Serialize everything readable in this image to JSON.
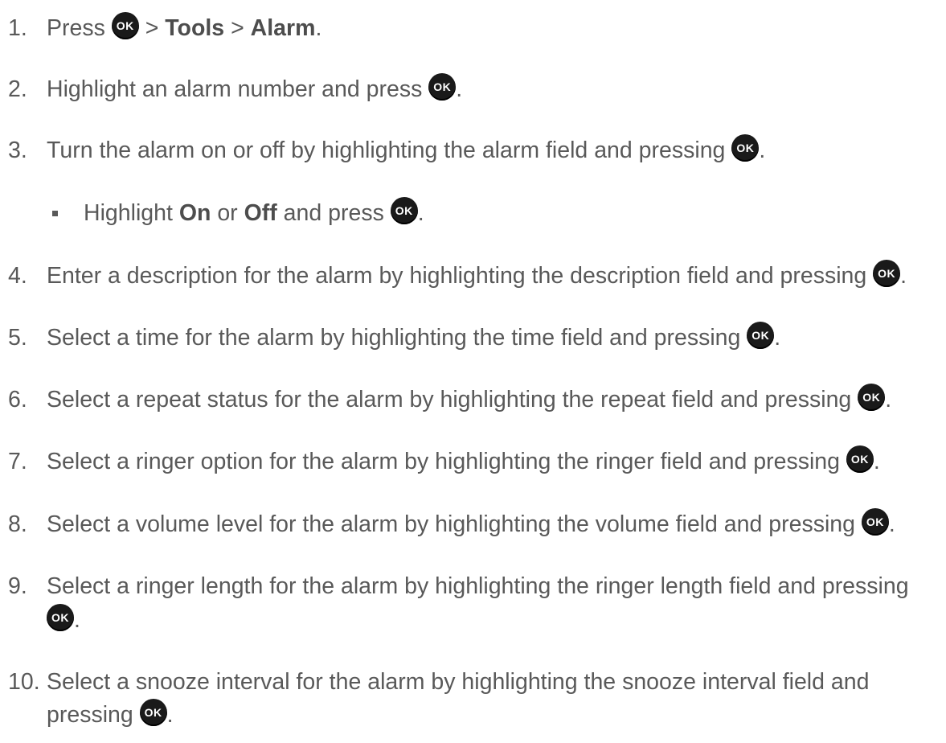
{
  "ok_button_label": "OK",
  "steps": [
    {
      "number": "1.",
      "a": "Press ",
      "b": " > ",
      "c": "Tools",
      "d": " > ",
      "e": "Alarm",
      "f": "."
    },
    {
      "number": "2.",
      "a": "Highlight an alarm number and press ",
      "b": "."
    },
    {
      "number": "3.",
      "a": "Turn the alarm on or off by highlighting the alarm field and pressing ",
      "b": "."
    },
    {
      "bullet": true,
      "a": "Highlight ",
      "b": "On",
      "c": " or ",
      "d": "Off",
      "e": " and press ",
      "f": "."
    },
    {
      "number": "4.",
      "a": "Enter a description for the alarm by highlighting the description field and pressing ",
      "b": "."
    },
    {
      "number": "5.",
      "a": "Select a time for the alarm by highlighting the time field and pressing ",
      "b": "."
    },
    {
      "number": "6.",
      "a": "Select a repeat status for the alarm by highlighting the repeat field and pressing ",
      "b": "."
    },
    {
      "number": "7.",
      "a": "Select a ringer option for the alarm by highlighting the ringer field and pressing ",
      "b": "."
    },
    {
      "number": "8.",
      "a": "Select a volume level for the alarm by highlighting the volume field and pressing ",
      "b": "."
    },
    {
      "number": "9.",
      "a": "Select a ringer length for the alarm by highlighting the ringer length field and pressing",
      "b": "."
    },
    {
      "number": "10.",
      "a": "Select a snooze interval for the alarm by highlighting the snooze interval field and",
      "b": "pressing ",
      "c": "."
    }
  ]
}
